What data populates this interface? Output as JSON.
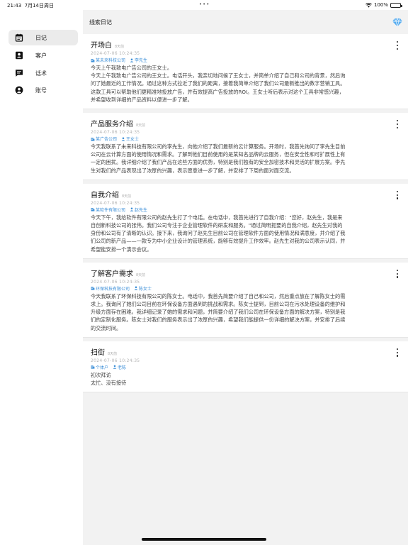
{
  "status_bar": {
    "time": "21:43",
    "date": "7月14日周日",
    "battery": "100%",
    "battery_level": 1.0
  },
  "sidebar": {
    "items": [
      {
        "label": "日记",
        "icon": "diary-icon",
        "active": true
      },
      {
        "label": "客户",
        "icon": "contact-icon",
        "active": false
      },
      {
        "label": "话术",
        "icon": "chat-icon",
        "active": false
      },
      {
        "label": "账号",
        "icon": "account-icon",
        "active": false
      }
    ]
  },
  "header": {
    "title": "线索日记",
    "action_icon": "diamond-icon"
  },
  "colors": {
    "accent": "#3c8fd8",
    "sidebar_active": "#ebebeb",
    "main_bg": "#f2f2f2"
  },
  "entries": [
    {
      "title": "开场白",
      "ago": "8天前",
      "date": "2024-07-06 10:24:35",
      "company": "某未来科技公司",
      "person": "李先生",
      "lines": [
        "今天上午我致电广告公司的王女士。",
        "今天上午我致电广告公司的王女士。电话开头，我亲切地问候了王女士，并简单介绍了自己和公司的背景，然后询",
        "问了她最近的工作情况。通过这种方式拉近了我们的距离，接着我简单介绍了我们公司最新推出的数字营销工具。",
        "这款工具可以帮助他们更精准地投放广告，并有效提高广告投放的ROI。王女士听后表示对这个工具非常感兴趣，",
        "并希望收到详细的产品资料以便进一步了解。"
      ]
    },
    {
      "title": "产品服务介绍",
      "ago": "8天前",
      "date": "2024-07-06 10:24:35",
      "company": "某广告公司",
      "person": "王女士",
      "lines": [
        "今天我联系了未来科技有限公司的李先生，向他介绍了我们最新的云计算服务。开场时，我首先询问了李先生目前",
        "公司在云计算方面的使用情况和需求。了解到他们目前使用的是某知名品牌的云服务，但在安全性和可扩展性上有",
        "一定的困扰。我详细介绍了我们产品在这些方面的优势，特别是我们独有的安全加密技术和灵活的扩展方案。李先",
        "生对我们的产品表现出了浓厚的兴趣，表示愿意进一步了解，并安排了下周的面对面交流。"
      ]
    },
    {
      "title": "自我介绍",
      "ago": "8天前",
      "date": "2024-07-06 10:24:35",
      "company": "某软件有限公司",
      "person": "赵先生",
      "lines": [
        "今天下午，我给软件有限公司的赵先生打了个电话。在电话中，我首先进行了自我介绍：\"您好，赵先生，我是来",
        "自创新科技公司的张伟。我们公司专注于企业管理软件的研发和服务。\"通过简明扼要的自我介绍，赵先生对我的",
        "身份和公司有了清晰的认识。接下来，我询问了赵先生目前公司在管理软件方面的使用情况和满意度，并介绍了我",
        "们公司的新产品——一款专为中小企业设计的管理系统，能够有效提升工作效率。赵先生对我的公司表示认同，并",
        "希望能安排一个演示会议。"
      ]
    },
    {
      "title": "了解客户需求",
      "ago": "8天前",
      "date": "2024-07-06 10:24:35",
      "company": "环保科技有限公司",
      "person": "陈女士",
      "lines": [
        "今天我联系了环保科技有限公司的陈女士。电话中，我首先简要介绍了自己和公司，然后重点放在了解陈女士的需",
        "求上。我询问了她们公司目前在环保设备方面遇到的挑战和需求。陈女士提到，目前公司在污水处理设备的维护和",
        "升级方面存在困难。我详细记录了她的需求和问题，并简要介绍了我们公司在环保设备方面的解决方案，特别是我",
        "们的定制化服务。陈女士对我们的服务表示出了浓厚的兴趣，希望我们能提供一份详细的解决方案，并安排了后续",
        "的交流时间。"
      ]
    },
    {
      "title": "扫街",
      "ago": "8天前",
      "date": "2024-07-06 10:24:35",
      "company": "个体户",
      "person": "老陈",
      "lines": [
        "初次拜访",
        "太忙、没有接待"
      ]
    }
  ]
}
